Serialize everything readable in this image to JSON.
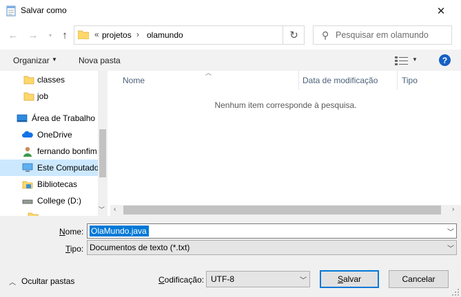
{
  "window": {
    "title": "Salvar como",
    "close_glyph": "✕"
  },
  "address": {
    "overflow_glyph": "«",
    "crumbs": [
      "projetos",
      "olamundo"
    ],
    "separator": "›",
    "refresh_glyph": "↻"
  },
  "search": {
    "placeholder": "Pesquisar em olamundo"
  },
  "toolbar": {
    "organize_label": "Organizar",
    "new_folder_label": "Nova pasta",
    "help_glyph": "?"
  },
  "nav": {
    "items": [
      {
        "label": "classes",
        "icon": "folder-icon"
      },
      {
        "label": "job",
        "icon": "folder-icon"
      },
      {
        "label": "Área de Trabalho",
        "icon": "desktop-icon"
      },
      {
        "label": "OneDrive",
        "icon": "cloud-icon"
      },
      {
        "label": "fernando bonfim",
        "icon": "user-icon"
      },
      {
        "label": "Este Computador",
        "icon": "computer-icon",
        "selected": true
      },
      {
        "label": "Bibliotecas",
        "icon": "library-icon"
      },
      {
        "label": "College (D:)",
        "icon": "drive-icon"
      }
    ]
  },
  "filelist": {
    "columns": [
      "Nome",
      "Data de modificação",
      "Tipo"
    ],
    "empty_message": "Nenhum item corresponde à pesquisa."
  },
  "form": {
    "name_label_accel": "N",
    "name_label_rest": "ome:",
    "name_value": "OlaMundo.java",
    "type_label_accel": "T",
    "type_label_rest": "ipo:",
    "type_value": "Documentos de texto (*.txt)",
    "encoding_label_accel": "C",
    "encoding_label_rest": "odificação:",
    "encoding_value": "UTF-8"
  },
  "footer": {
    "hide_folders_label": "Ocultar pastas",
    "save_accel": "S",
    "save_rest": "alvar",
    "cancel_label": "Cancelar"
  },
  "colors": {
    "accent": "#0078d7",
    "selection": "#cce8ff",
    "help": "#1560c4",
    "folder": "#ffd86b"
  }
}
